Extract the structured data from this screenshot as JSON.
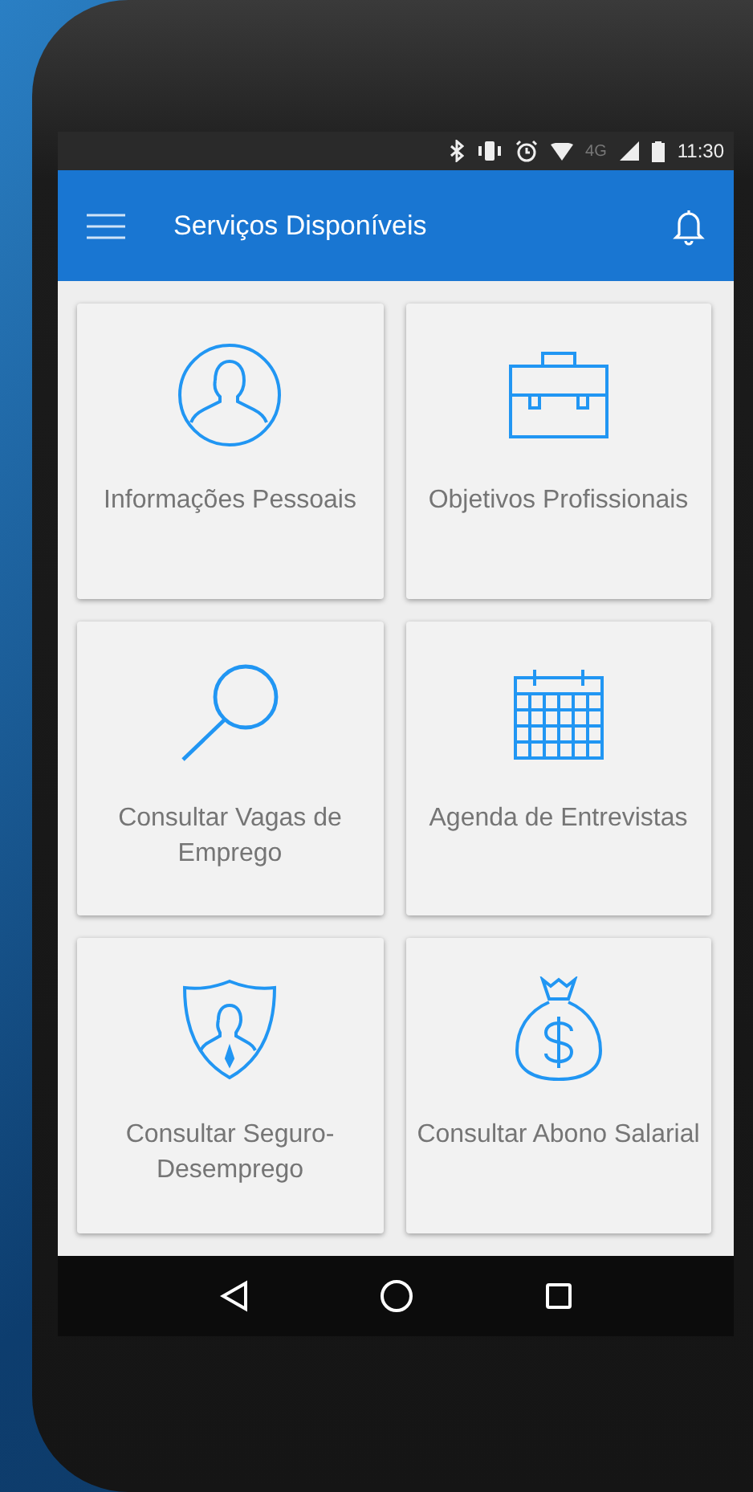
{
  "status_bar": {
    "time": "11:30",
    "network": "4G"
  },
  "app_bar": {
    "title": "Serviços Disponíveis"
  },
  "services": [
    {
      "kind": "person",
      "label": "Informações Pessoais"
    },
    {
      "kind": "briefcase",
      "label": "Objetivos Profissionais"
    },
    {
      "kind": "search",
      "label": "Consultar Vagas de Emprego"
    },
    {
      "kind": "calendar",
      "label": "Agenda de Entrevistas"
    },
    {
      "kind": "shield",
      "label": "Consultar Seguro-Desemprego"
    },
    {
      "kind": "moneybag",
      "label": "Consultar Abono Salarial"
    }
  ]
}
